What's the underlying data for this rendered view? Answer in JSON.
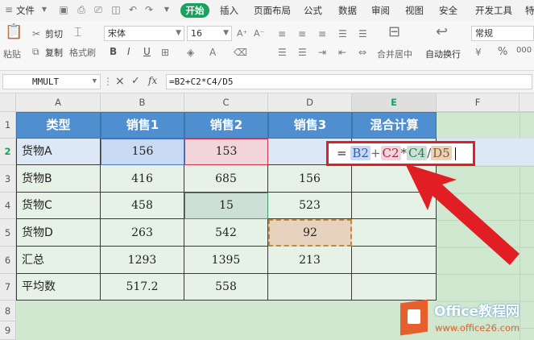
{
  "menu": {
    "file": "文件",
    "tabs": [
      "开始",
      "插入",
      "页面布局",
      "公式",
      "数据",
      "审阅",
      "视图",
      "安全",
      "开发工具",
      "特"
    ]
  },
  "ribbon": {
    "paste": "粘贴",
    "cut": "剪切",
    "copy": "复制",
    "format_painter": "格式刷",
    "font_name": "宋体",
    "font_size": "16",
    "merge_center": "合并居中",
    "wrap_text": "自动换行",
    "number_format": "常规",
    "bold": "B",
    "italic": "I",
    "underline": "U",
    "percent": "%",
    "thousands": "000"
  },
  "formula_bar": {
    "name_box": "MMULT",
    "cancel": "×",
    "confirm": "✓",
    "fx": "fx",
    "formula": "=B2+C2*C4/D5"
  },
  "grid": {
    "columns": [
      "A",
      "B",
      "C",
      "D",
      "E",
      "F"
    ],
    "rows": [
      "1",
      "2",
      "3",
      "4",
      "5",
      "6",
      "7",
      "8",
      "9"
    ],
    "header": [
      "类型",
      "销售1",
      "销售2",
      "销售3",
      "混合计算"
    ],
    "data": [
      [
        "货物A",
        "156",
        "153",
        "",
        ""
      ],
      [
        "货物B",
        "416",
        "685",
        "156",
        ""
      ],
      [
        "货物C",
        "458",
        "15",
        "523",
        ""
      ],
      [
        "货物D",
        "263",
        "542",
        "92",
        ""
      ],
      [
        "汇总",
        "1293",
        "1395",
        "213",
        ""
      ],
      [
        "平均数",
        "517.2",
        "558",
        "",
        ""
      ]
    ]
  },
  "edit": {
    "eq": "=",
    "r1": "B2",
    "op1": "+",
    "r2": "C2",
    "op2": "*",
    "r3": "C4",
    "op3": "/",
    "r4": "D5"
  },
  "watermark": {
    "brand": "Office教程网",
    "url": "www.office26.com"
  },
  "colors": {
    "accent_green": "#19a15f",
    "header_blue": "#4f8fd0",
    "highlight_red": "#e01e23",
    "ref_b2": "#c9d9f1",
    "ref_c2": "#f1d5da",
    "ref_c4": "#cde0d8",
    "ref_d5": "#e6d2bd"
  }
}
